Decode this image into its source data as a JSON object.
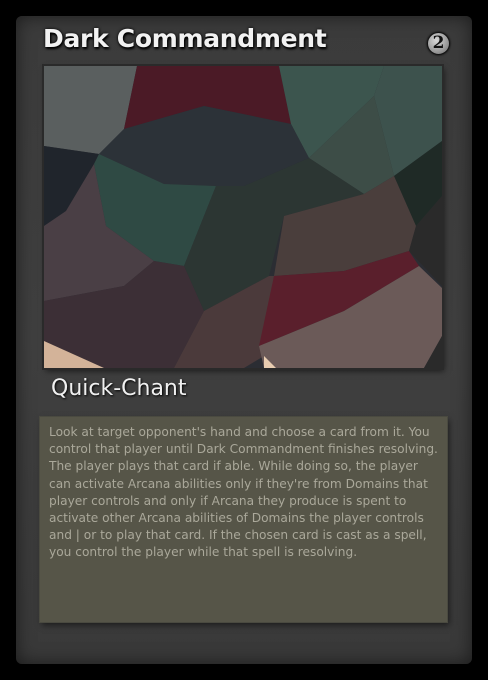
{
  "card": {
    "title": "Dark Commandment",
    "cost": "2",
    "type_line": "Quick-Chant",
    "rules_text": "Look at target opponent's hand and choose a card from it. You control that player until Dark Commandment finishes resolving. The player plays that card if able. While doing so, the player can activate Arcana abilities only if they're from Domains that player controls and only if Arcana they produce is spent to activate other Arcana abilities of Domains the player controls and | or to play that card. If the chosen card is cast as a spell, you control the player while that spell is resolving."
  },
  "colors": {
    "frame": "#3d3d3d",
    "text_box": "#565548",
    "rules_text": "#aaa89a",
    "title": "#f2f2f2"
  }
}
